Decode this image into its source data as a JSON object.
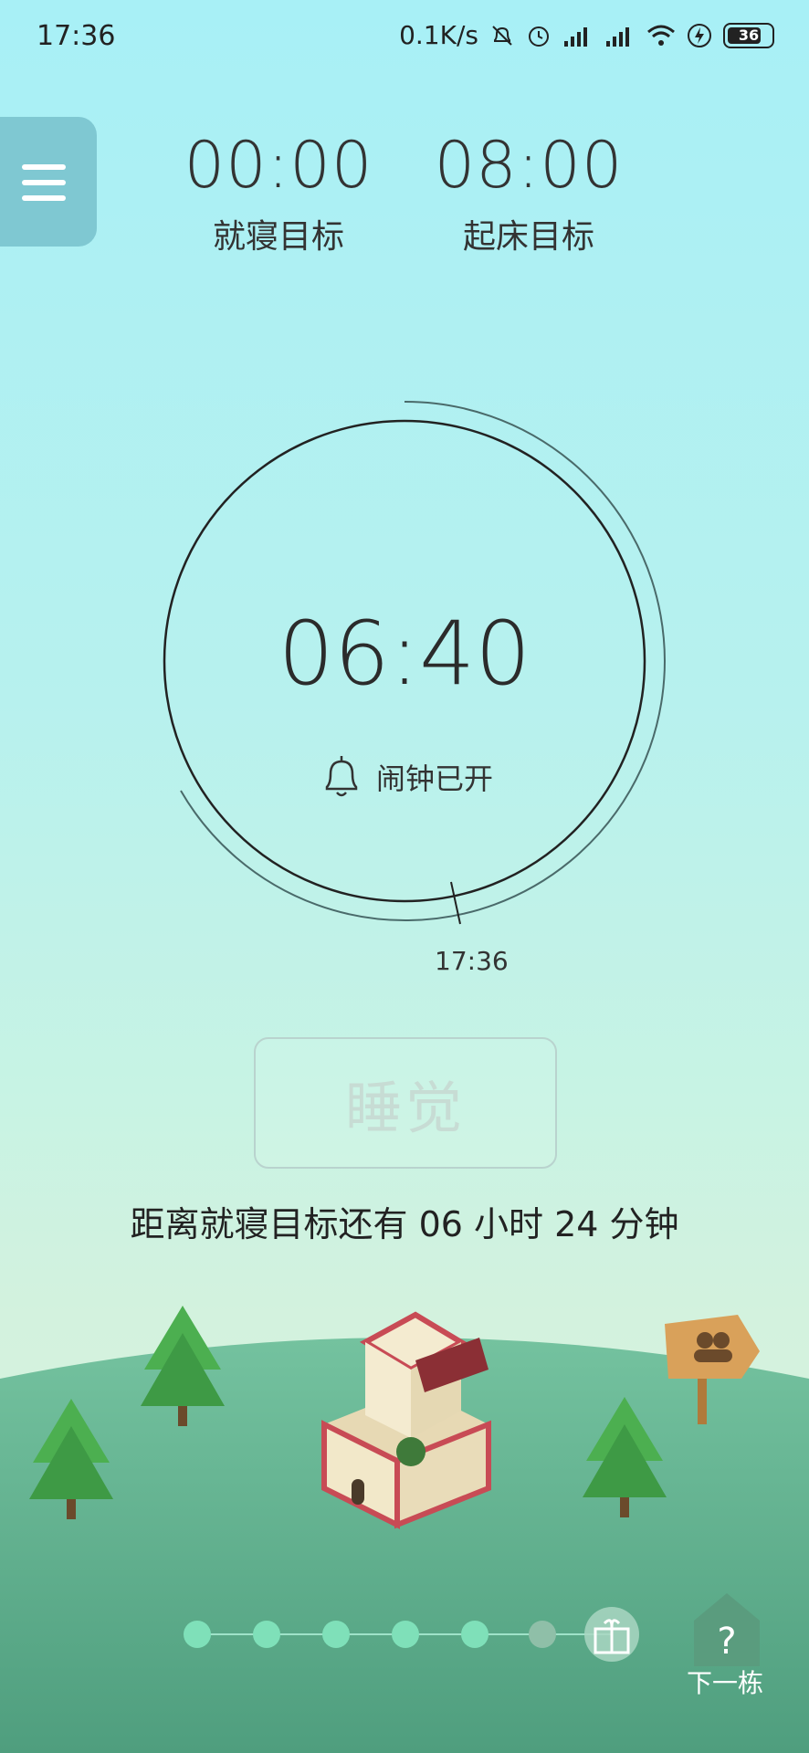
{
  "status_bar": {
    "time": "17:36",
    "network_speed": "0.1K/s",
    "battery": "36"
  },
  "goals": {
    "bedtime": {
      "time": "00:00",
      "label": "就寝目标"
    },
    "wake": {
      "time": "08:00",
      "label": "起床目标"
    }
  },
  "clock": {
    "time_remaining": "06:40",
    "alarm_status": "闹钟已开",
    "current_time": "17:36"
  },
  "sleep_button": {
    "label": "睡觉"
  },
  "countdown_text": "距离就寝目标还有 06 小时 24 分钟",
  "bottom": {
    "next_building_label": "下一栋",
    "progress_dots": {
      "total": 6,
      "completed": 5
    }
  },
  "colors": {
    "menu_bg": "#7fc8d2",
    "dot_active": "#7fe0b9",
    "ground": "#6fbf9a"
  }
}
